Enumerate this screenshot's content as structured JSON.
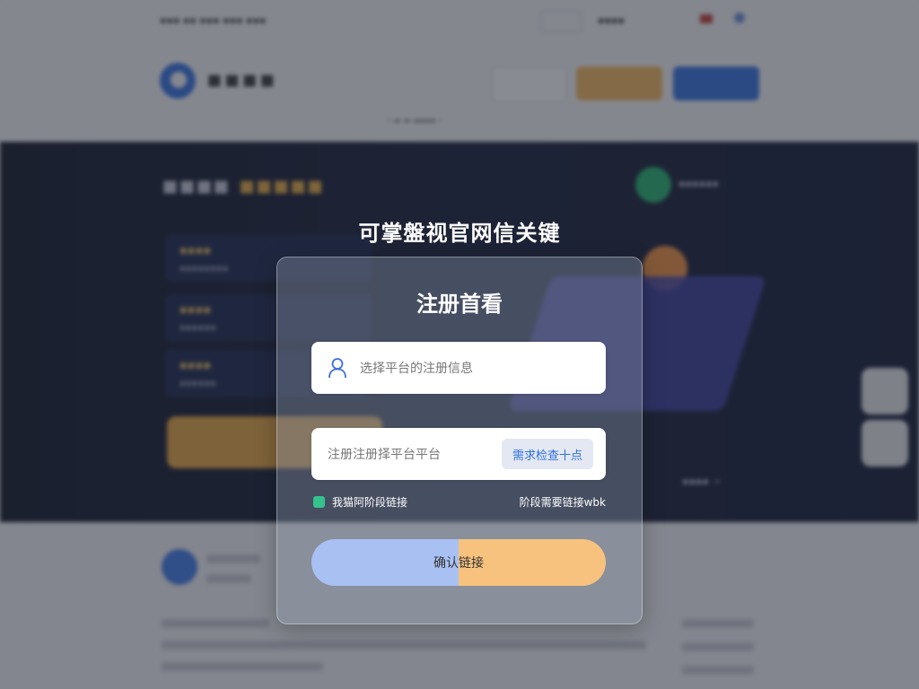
{
  "page": {
    "modal_heading": "可掌盤视官网信关键"
  },
  "modal": {
    "title": "注册首看",
    "username_placeholder": "选择平台的注册信息",
    "code_placeholder": "注册注册择平台平台",
    "code_button": "需求检查十点",
    "agree_label": "我猫阿阶段链接",
    "help_link": "阶段需要链接wbk",
    "submit_label": "确认链接"
  },
  "colors": {
    "accent_blue": "#2f6fe0",
    "accent_orange": "#f4b65a",
    "checkbox_green": "#34c38f",
    "submit_left": "#a9c0f3",
    "submit_right": "#f7c27d"
  },
  "icons": {
    "user_field_icon": "user-icon"
  }
}
